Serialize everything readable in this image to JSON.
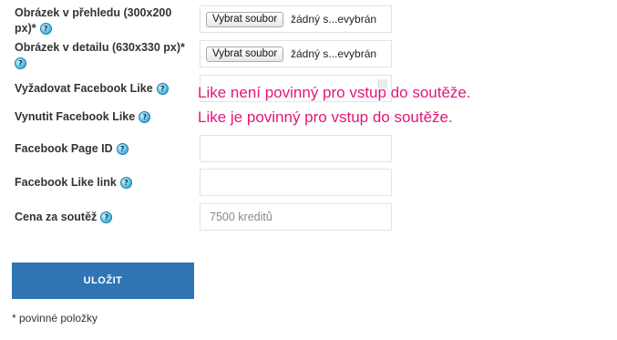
{
  "fields": {
    "overview_image": {
      "label_line1": "Obrázek v přehledu (300x200",
      "label_line2": "px)*",
      "button": "Vybrat soubor",
      "file": "žádný s...evybrán"
    },
    "detail_image": {
      "label": "Obrázek v detailu (630x330 px)*",
      "button": "Vybrat soubor",
      "file": "žádný s...evybrán"
    },
    "require_like": {
      "label": "Vyžadovat Facebook Like"
    },
    "force_like": {
      "label": "Vynutit Facebook Like"
    },
    "page_id": {
      "label": "Facebook Page ID",
      "value": ""
    },
    "like_link": {
      "label": "Facebook Like link",
      "value": ""
    },
    "price": {
      "label": "Cena za soutěž",
      "placeholder": "7500 kreditů"
    }
  },
  "help_glyph": "?",
  "tooltips": {
    "not_required": "Like není povinný pro vstup do soutěže.",
    "required": "Like je povinný pro vstup do soutěže."
  },
  "save_button": "ULOŽIT",
  "footnote": "* povinné položky"
}
